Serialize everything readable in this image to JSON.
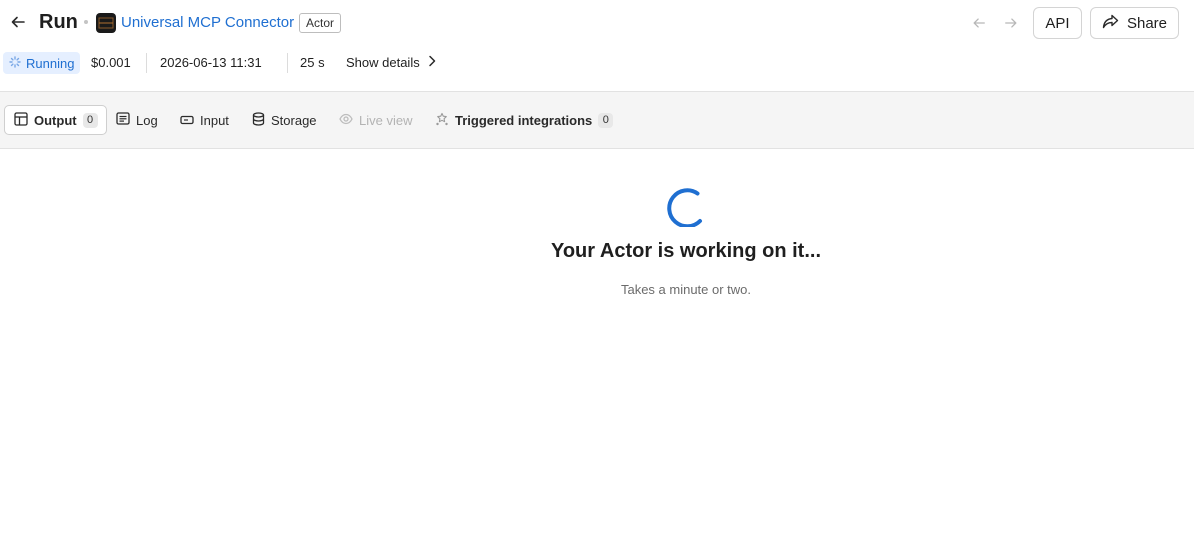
{
  "header": {
    "title": "Run",
    "actor_name": "Universal MCP Connector",
    "actor_tag": "Actor",
    "api_label": "API",
    "share_label": "Share"
  },
  "status": {
    "state": "Running",
    "cost": "$0.001",
    "started": "2026-06-13 11:31",
    "duration": "25 s",
    "details_label": "Show details"
  },
  "tabs": [
    {
      "label": "Output",
      "count": "0",
      "icon": "table-icon",
      "active": true
    },
    {
      "label": "Log",
      "icon": "log-icon"
    },
    {
      "label": "Input",
      "icon": "input-icon"
    },
    {
      "label": "Storage",
      "icon": "database-icon"
    },
    {
      "label": "Live view",
      "icon": "eye-icon",
      "disabled": true
    },
    {
      "label": "Triggered integrations",
      "count": "0",
      "icon": "integrations-icon"
    }
  ],
  "main": {
    "heading": "Your Actor is working on it...",
    "subtext": "Takes a minute or two."
  },
  "colors": {
    "accent": "#1f6fd1",
    "running_bg": "#e5efff",
    "tabbar_bg": "#f5f5f5"
  }
}
